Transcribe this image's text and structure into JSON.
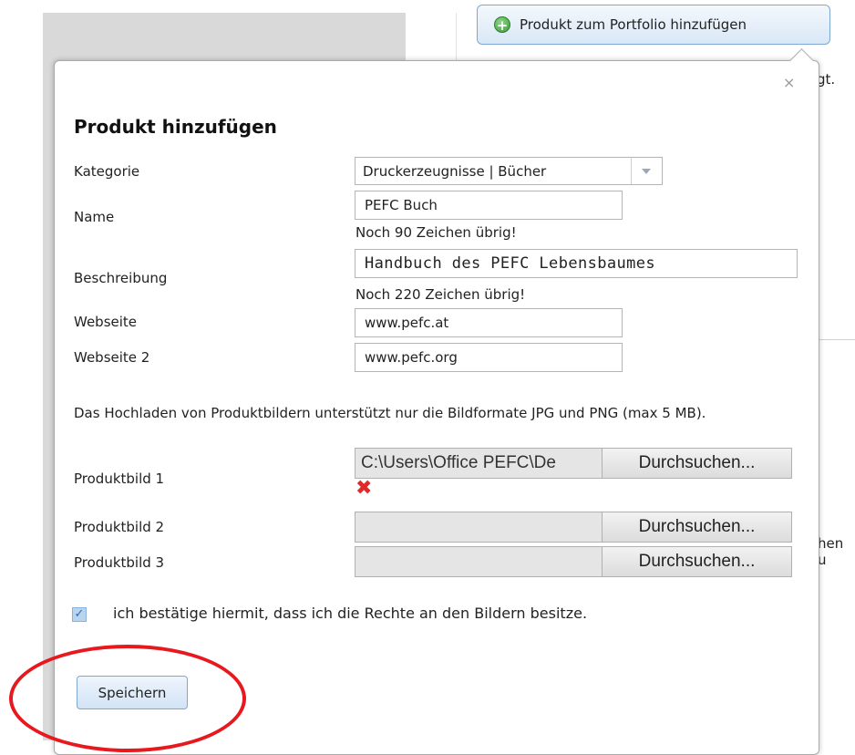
{
  "background": {
    "add_product_label": "Produkt zum Portfolio hinzufügen",
    "partial_text_1": "gt.",
    "partial_text_2": "hen u"
  },
  "dialog": {
    "close_symbol": "×",
    "title": "Produkt hinzufügen",
    "fields": {
      "category": {
        "label": "Kategorie",
        "value": "Druckerzeugnisse | Bücher"
      },
      "name": {
        "label": "Name",
        "value": "PEFC Buch",
        "hint": "Noch 90 Zeichen übrig!"
      },
      "description": {
        "label": "Beschreibung",
        "value": "Handbuch des PEFC Lebensbaumes",
        "hint": "Noch 220 Zeichen übrig!"
      },
      "website": {
        "label": "Webseite",
        "value": "www.pefc.at"
      },
      "website2": {
        "label": "Webseite 2",
        "value": "www.pefc.org"
      }
    },
    "upload_info": "Das Hochladen von Produktbildern unterstützt nur die Bildformate JPG und PNG (max 5 MB).",
    "images": [
      {
        "label": "Produktbild 1",
        "path": "C:\\Users\\Office PEFC\\De",
        "browse": "Durchsuchen..."
      },
      {
        "label": "Produktbild 2",
        "path": "",
        "browse": "Durchsuchen..."
      },
      {
        "label": "Produktbild 3",
        "path": "",
        "browse": "Durchsuchen..."
      }
    ],
    "remove_symbol": "✖",
    "rights_checkbox": {
      "checked": true,
      "label": "ich bestätige hiermit, dass ich die Rechte an den Bildern besitze."
    },
    "save_label": "Speichern"
  },
  "colors": {
    "accent_border": "#7fa7d3",
    "remove_red": "#e02a2a",
    "annotation_red": "#e8191e"
  }
}
